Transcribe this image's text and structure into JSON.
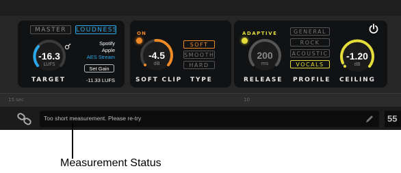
{
  "target": {
    "modes": [
      "MASTER",
      "LOUDNESS"
    ],
    "active_mode": "LOUDNESS",
    "value": "-16.3",
    "unit": "LUFS",
    "platforms": [
      "Spotify",
      "Apple",
      "AES Stream"
    ],
    "highlighted_platform": "AES Stream",
    "set_gain_label": "Set Gain",
    "gain_value": "-11.33 LUFS",
    "label": "TARGET"
  },
  "soft_clip": {
    "on_label": "ON",
    "value": "-4.5",
    "unit": "dB",
    "label": "SOFT CLIP",
    "type_options": [
      "SOFT",
      "SMOOTH",
      "HARD"
    ],
    "selected_type": "SOFT",
    "type_label": "TYPE"
  },
  "release": {
    "adaptive_label": "ADAPTIVE",
    "value": "200",
    "unit": "ms",
    "label": "RELEASE"
  },
  "profile": {
    "options": [
      "GENERAL",
      "ROCK",
      "ACOUSTIC",
      "VOCALS"
    ],
    "selected": "VOCALS",
    "label": "PROFILE"
  },
  "ceiling": {
    "value": "-1.20",
    "unit": "dB",
    "label": "CEILING"
  },
  "timeline": {
    "tick_left": "15 sec",
    "tick_mid": "10"
  },
  "status": {
    "message": "Too short measurement. Please re-try",
    "number": "55"
  },
  "callout": {
    "text": "Measurement Status"
  },
  "colors": {
    "accent_blue": "#2aa7e8",
    "accent_orange": "#f08a24",
    "accent_yellow": "#e4dd3a"
  }
}
